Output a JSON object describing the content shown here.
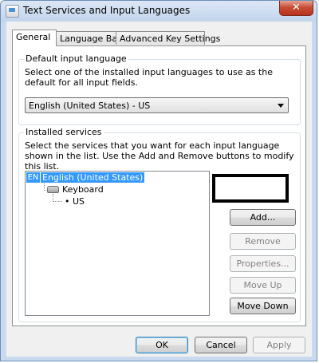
{
  "window": {
    "title": "Text Services and Input Languages",
    "close_glyph": "✕",
    "app_icon": "text-services-icon"
  },
  "tabs": [
    {
      "label": "General",
      "active": true
    },
    {
      "label": "Language Bar",
      "active": false
    },
    {
      "label": "Advanced Key Settings",
      "active": false
    }
  ],
  "default_language": {
    "group_label": "Default input language",
    "description": "Select one of the installed input languages to use as the default for all input fields.",
    "selected": "English (United States) - US"
  },
  "installed_services": {
    "group_label": "Installed services",
    "description": "Select the services that you want for each input language shown in the list. Use the Add and Remove buttons to modify this list.",
    "tree": {
      "language_code": "EN",
      "language_name": "English (United States)",
      "category": "Keyboard",
      "bullet": "•",
      "service": "US"
    },
    "buttons": [
      {
        "label": "Add...",
        "enabled": true
      },
      {
        "label": "Remove",
        "enabled": false
      },
      {
        "label": "Properties...",
        "enabled": false
      },
      {
        "label": "Move Up",
        "enabled": false
      },
      {
        "label": "Move Down",
        "enabled": true
      }
    ]
  },
  "footer": {
    "ok": "OK",
    "cancel": "Cancel",
    "apply": "Apply",
    "apply_enabled": false
  },
  "colors": {
    "selection": "#3399ff",
    "annotation_highlight": "#000000"
  }
}
